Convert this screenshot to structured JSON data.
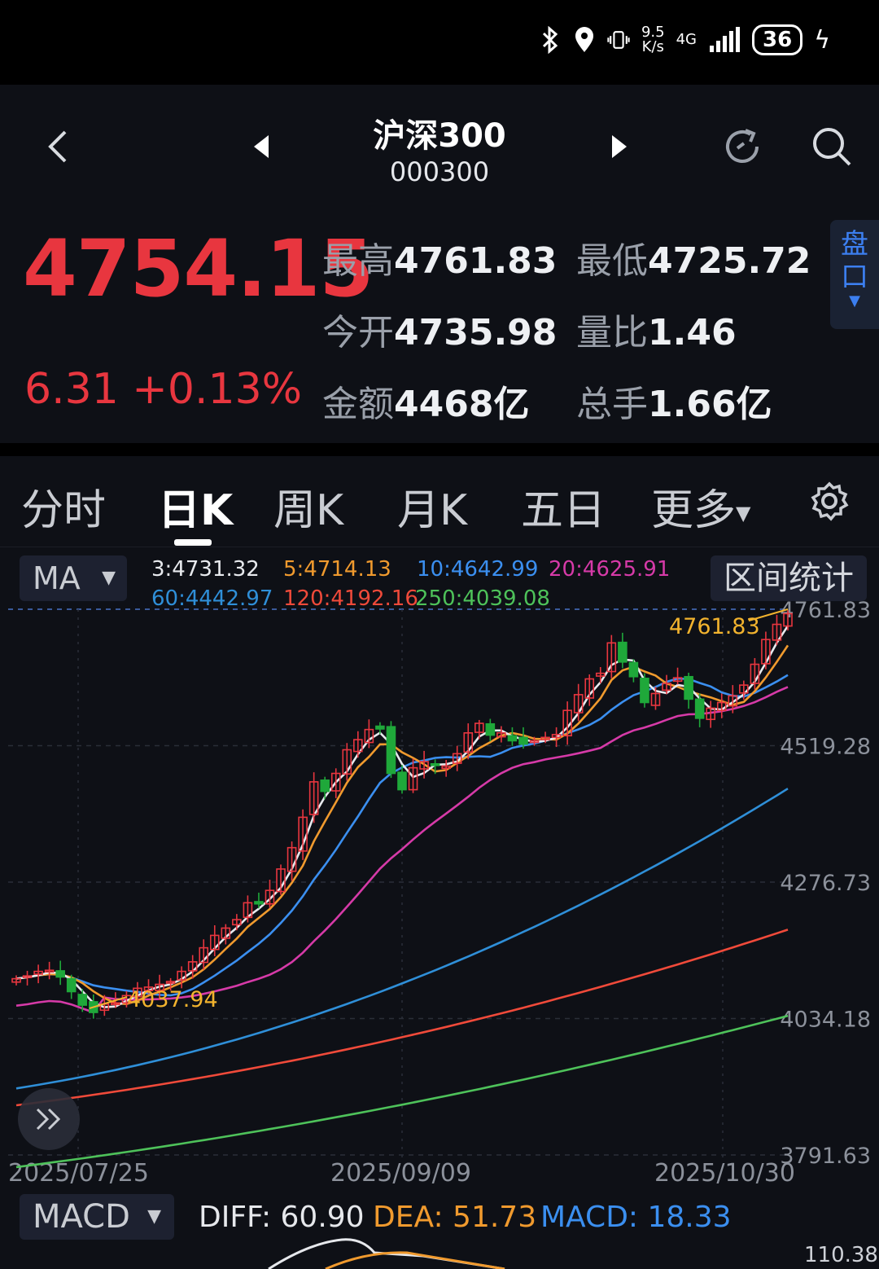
{
  "status": {
    "speed_top": "9.5",
    "speed_bottom": "K/s",
    "net": "4G",
    "battery": "36"
  },
  "header": {
    "title": "沪深300",
    "code": "000300"
  },
  "quote": {
    "price": "4754.15",
    "change": "6.31 +0.13%",
    "items": [
      {
        "k": "最高",
        "v": "4761.83"
      },
      {
        "k": "最低",
        "v": "4725.72"
      },
      {
        "k": "今开",
        "v": "4735.98"
      },
      {
        "k": "量比",
        "v": "1.46"
      },
      {
        "k": "金额",
        "v": "4468亿"
      },
      {
        "k": "总手",
        "v": "1.66亿"
      }
    ],
    "pankou": "盘口"
  },
  "tabs": [
    "分时",
    "日K",
    "周K",
    "月K",
    "五日",
    "更多"
  ],
  "ma": {
    "select": "MA",
    "values": [
      {
        "label": "3:4731.32",
        "color": "#e8eaee"
      },
      {
        "label": "5:4714.13",
        "color": "#f09a2e"
      },
      {
        "label": "10:4642.99",
        "color": "#3b8ff0"
      },
      {
        "label": "20:4625.91",
        "color": "#d63aa8"
      },
      {
        "label": "60:4442.97",
        "color": "#2f8fd8"
      },
      {
        "label": "120:4192.16",
        "color": "#f04a3a"
      },
      {
        "label": "250:4039.08",
        "color": "#4ec25a"
      }
    ],
    "range_button": "区间统计"
  },
  "chart_data": {
    "type": "candlestick",
    "y_ticks": [
      "4761.83",
      "4519.28",
      "4276.73",
      "4034.18",
      "3791.63"
    ],
    "ylim": [
      3791.63,
      4761.83
    ],
    "x_ticks": [
      "2025/07/25",
      "2025/09/09",
      "2025/10/30"
    ],
    "annotations": [
      {
        "label": "4761.83",
        "kind": "high"
      },
      {
        "label": "4037.94",
        "kind": "low"
      }
    ],
    "closes": [
      4105,
      4110,
      4118,
      4120,
      4108,
      4082,
      4058,
      4045,
      4060,
      4062,
      4075,
      4088,
      4090,
      4095,
      4100,
      4118,
      4135,
      4160,
      4182,
      4195,
      4210,
      4240,
      4238,
      4262,
      4300,
      4338,
      4392,
      4455,
      4438,
      4470,
      4512,
      4530,
      4548,
      4549,
      4470,
      4441,
      4480,
      4491,
      4485,
      4483,
      4505,
      4542,
      4559,
      4538,
      4542,
      4528,
      4522,
      4528,
      4534,
      4539,
      4582,
      4610,
      4638,
      4648,
      4702,
      4668,
      4642,
      4596,
      4612,
      4630,
      4640,
      4602,
      4568,
      4586,
      4596,
      4608,
      4627,
      4664,
      4708,
      4735,
      4754
    ],
    "ma60_end": 4442.97,
    "ma120_end": 4192.16,
    "ma250_end": 4039.08
  },
  "macd": {
    "select": "MACD",
    "diff": "DIFF: 60.90",
    "dea": "DEA: 51.73",
    "macd": "MACD: 18.33",
    "top_tick": "110.38"
  }
}
